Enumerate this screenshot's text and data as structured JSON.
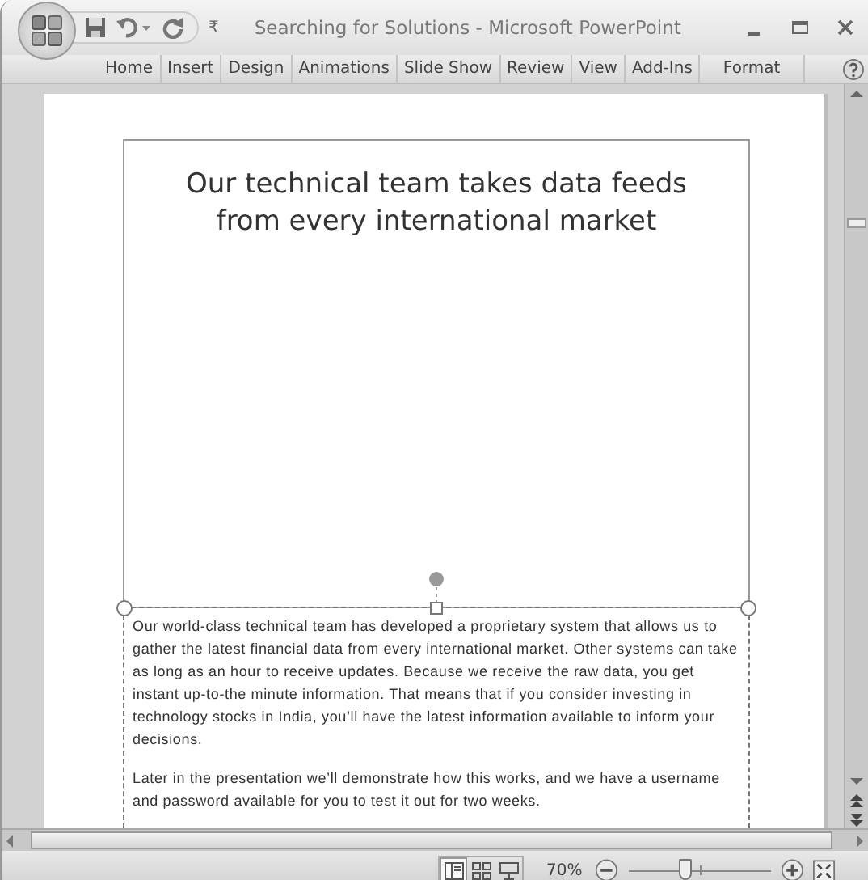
{
  "window": {
    "title": "Searching for Solutions - Microsoft PowerPoint"
  },
  "quick_access": {
    "menu_glyph": "₹"
  },
  "tabs": [
    {
      "label": "Home"
    },
    {
      "label": "Insert"
    },
    {
      "label": "Design"
    },
    {
      "label": "Animations"
    },
    {
      "label": "Slide Show"
    },
    {
      "label": "Review"
    },
    {
      "label": "View"
    },
    {
      "label": "Add-Ins"
    },
    {
      "label": "Format",
      "kind": "contextual"
    }
  ],
  "slide": {
    "title": "Our technical team takes data feeds from every international market"
  },
  "notes": {
    "paragraphs": [
      "Our world-class technical team has developed a proprietary system that allows us to gather the latest financial data from every international market. Other systems can take as long as  an hour to receive updates. Because we receive the raw data, you get instant up-to-the minute information. That means that if you consider investing in technology stocks in India, you’ll have the latest information available to inform your decisions.",
      "Later in the presentation we’ll demonstrate how this works, and we have a username and password available for you to test it out for two weeks."
    ]
  },
  "status_bar": {
    "views": [
      {
        "kind": "normal",
        "selected": true
      },
      {
        "kind": "sorter",
        "selected": false
      },
      {
        "kind": "show",
        "selected": false
      }
    ],
    "zoom": "70%",
    "zoom_slider": {
      "level": 0.4
    }
  }
}
